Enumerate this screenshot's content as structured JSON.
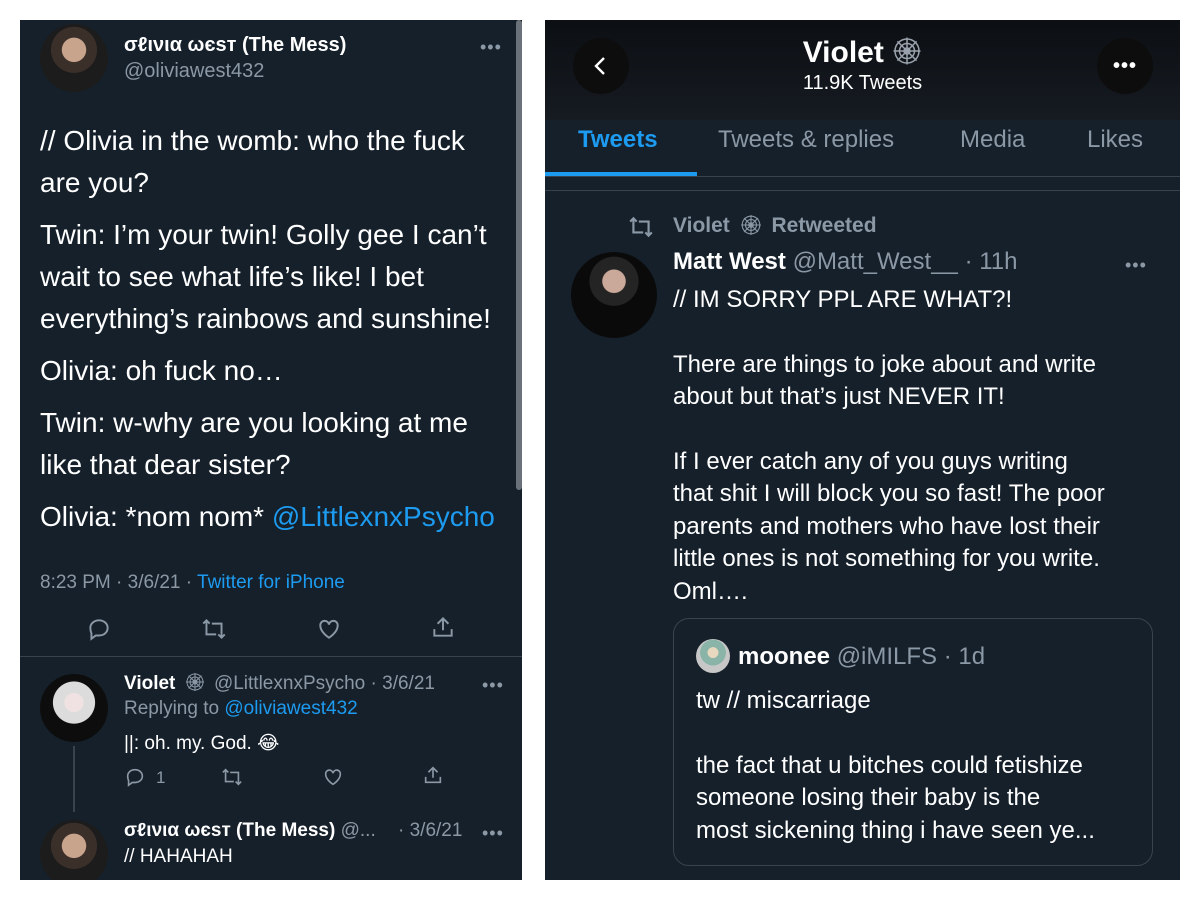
{
  "left": {
    "main_tweet": {
      "display_name": "σℓινια ωєѕт (The Mess)",
      "handle": "@oliviawest432",
      "more": "•••",
      "paragraphs": [
        "// Olivia in the womb: who the fuck are you?",
        "Twin: I’m your twin! Golly gee I can’t wait to see what life’s like! I bet everything’s rainbows and sunshine!",
        "Olivia: oh fuck no…",
        "Twin: w-why are you looking at me like that dear sister?"
      ],
      "last_line_prefix": "Olivia: *nom nom* ",
      "last_line_mention": "@LittlexnxPsycho",
      "timestamp": "8:23 PM · 3/6/21 · ",
      "source": "Twitter for iPhone"
    },
    "reply": {
      "display_name": "Violet",
      "handle_time": "@LittlexnxPsycho · 3/6/21",
      "more": "•••",
      "replying_to_label": "Replying to ",
      "replying_to_handle": "@oliviawest432",
      "text": "||: oh. my. God. 😂",
      "reply_count": "1"
    },
    "reply2": {
      "display_name": "σℓινια ωєѕт (The Mess)",
      "handle": "@...",
      "time": "· 3/6/21",
      "more": "•••",
      "text": "// HAHAHAH"
    }
  },
  "right": {
    "header": {
      "title": "Violet",
      "subtitle": "11.9K Tweets",
      "more": "•••"
    },
    "tabs": [
      "Tweets",
      "Tweets & replies",
      "Media",
      "Likes"
    ],
    "active_tab": "Tweets",
    "retweet_label": {
      "name": "Violet",
      "action": "Retweeted"
    },
    "tweet": {
      "display_name": "Matt West",
      "handle": "@Matt_West__",
      "time": "· 11h",
      "more": "•••",
      "lines_block1": [
        "// IM SORRY PPL ARE WHAT?!"
      ],
      "lines_block2": [
        "There are things to joke about and write",
        "about but that’s just NEVER IT!"
      ],
      "lines_block3": [
        "If I ever catch any of you guys writing",
        "that shit I will block you so fast! The poor",
        "parents and mothers who have lost their",
        "little ones is not something for you write.",
        "Oml…."
      ]
    },
    "quote": {
      "display_name": "moonee",
      "handle": "@iMILFS",
      "time": "· 1d",
      "line1": "tw // miscarriage",
      "lines": [
        "the fact that u bitches could fetishize",
        "someone losing their baby is the",
        "most sickening thing i have seen ye..."
      ]
    }
  },
  "colors": {
    "background": "#15202b",
    "accent": "#1d9bf0",
    "muted": "#8b98a5",
    "divider": "#38444d"
  }
}
